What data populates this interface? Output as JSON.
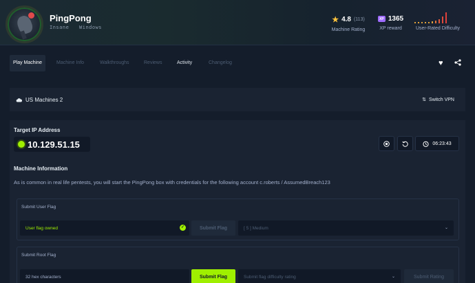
{
  "machine": {
    "name": "PingPong",
    "difficulty": "Insane",
    "os": "Windows"
  },
  "stats": {
    "rating_value": "4.8",
    "rating_count": "(113)",
    "rating_label": "Machine Rating",
    "xp_icon": "XP",
    "xp_value": "1365",
    "xp_label": "XP reward",
    "difficulty_label": "User-Rated Difficulty"
  },
  "tabs": [
    {
      "label": "Play Machine"
    },
    {
      "label": "Machine Info"
    },
    {
      "label": "Walkthroughs"
    },
    {
      "label": "Reviews"
    },
    {
      "label": "Activity"
    },
    {
      "label": "Changelog"
    }
  ],
  "vpn": {
    "server": "US Machines 2",
    "switch_label": "Switch VPN"
  },
  "target": {
    "label": "Target IP Address",
    "ip": "10.129.51.15",
    "timer": "06:23:43"
  },
  "info": {
    "heading": "Machine Information",
    "text": "As is common in real life pentests, you will start the PingPong box with credentials for the following account c.roberts / AssumedBreach123"
  },
  "user_flag": {
    "heading": "Submit User Flag",
    "value": "User flag owned",
    "submit_label": "Submit Flag",
    "difficulty_value": "[ 5 ] Medium"
  },
  "root_flag": {
    "heading": "Submit Root Flag",
    "placeholder": "32 hex characters",
    "submit_label": "Submit Flag",
    "difficulty_placeholder": "Submit flag difficulty rating",
    "rating_label": "Submit Rating"
  },
  "colors": {
    "accent": "#9fef00",
    "background": "#141d2b",
    "panel": "#1a2332",
    "star": "#ffc43d",
    "xp": "#9f6bff"
  },
  "icons": [
    "star-icon",
    "xp-icon",
    "heart-icon",
    "share-icon",
    "cloud-icon",
    "switch-vpn-icon",
    "stop-icon",
    "reset-icon",
    "timer-icon",
    "check-icon",
    "chevron-down-icon"
  ]
}
